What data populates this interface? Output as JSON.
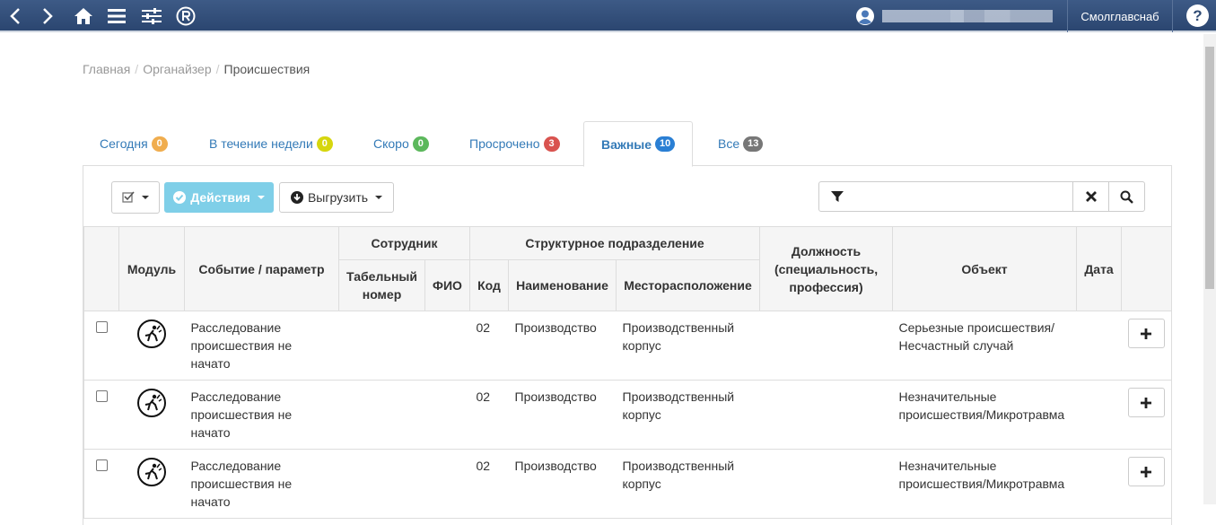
{
  "topbar": {
    "icons": [
      "back-arrow-icon",
      "forward-arrow-icon",
      "home-icon",
      "menu-icon",
      "settings-sliders-icon",
      "registered-icon"
    ],
    "org": "Смолглавснаб",
    "help": "?"
  },
  "breadcrumb": {
    "items": [
      "Главная",
      "Органайзер"
    ],
    "current": "Происшествия"
  },
  "tabs": [
    {
      "label": "Сегодня",
      "count": "0",
      "color": "#f0ad4e"
    },
    {
      "label": "В течение недели",
      "count": "0",
      "color": "#d6d60e"
    },
    {
      "label": "Скоро",
      "count": "0",
      "color": "#5cb85c"
    },
    {
      "label": "Просрочено",
      "count": "3",
      "color": "#d9534f"
    },
    {
      "label": "Важные",
      "count": "10",
      "color": "#2a7fd4"
    },
    {
      "label": "Все",
      "count": "13",
      "color": "#777777"
    }
  ],
  "toolbar": {
    "actions_label": "Действия",
    "export_label": "Выгрузить",
    "search_placeholder": ""
  },
  "table": {
    "headers": {
      "module": "Модуль",
      "event": "Событие / параметр",
      "employee": "Сотрудник",
      "tab_number": "Табельный номер",
      "fio": "ФИО",
      "division": "Структурное подразделение",
      "code": "Код",
      "name": "Наименование",
      "location": "Месторасположение",
      "position": "Должность (специальность, профессия)",
      "object": "Объект",
      "date": "Дата"
    },
    "rows": [
      {
        "event": "Расследование происшествия не начато",
        "code": "02",
        "name": "Производство",
        "location": "Производственный корпус",
        "object": "Серьезные происшествия/ Несчастный случай"
      },
      {
        "event": "Расследование происшествия не начато",
        "code": "02",
        "name": "Производство",
        "location": "Производственный корпус",
        "object": "Незначительные происшествия/Микротравма"
      },
      {
        "event": "Расследование происшествия не начато",
        "code": "02",
        "name": "Производство",
        "location": "Производственный корпус",
        "object": "Незначительные происшествия/Микротравма"
      }
    ]
  }
}
